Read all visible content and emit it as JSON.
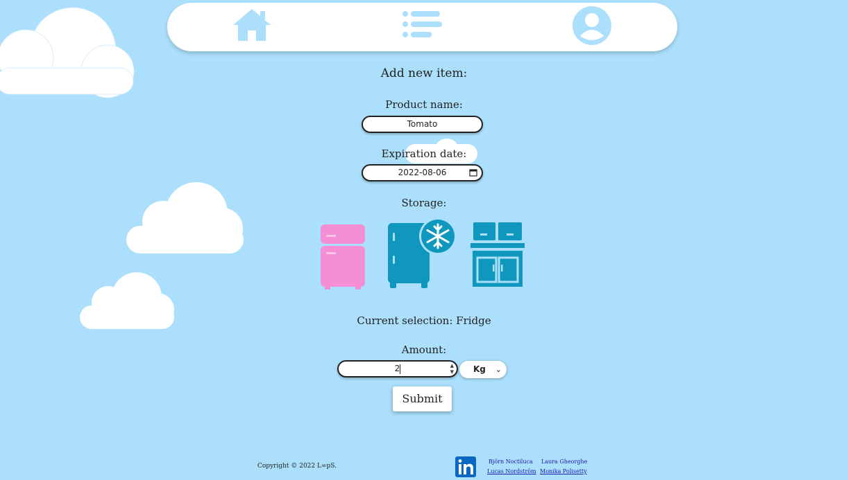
{
  "nav": {
    "home_icon": "home-icon",
    "list_icon": "list-icon",
    "profile_icon": "user-avatar-icon"
  },
  "form": {
    "heading": "Add new item:",
    "product_label": "Product name:",
    "product_value": "Tomato",
    "expiration_label": "Expiration date:",
    "expiration_value": "2022-08-06",
    "storage_label": "Storage:",
    "storage_options": [
      {
        "name": "Fridge",
        "icon": "fridge-icon",
        "color": "#f48fd6"
      },
      {
        "name": "Freezer",
        "icon": "freezer-icon",
        "color": "#0f97be"
      },
      {
        "name": "Cupboard",
        "icon": "cupboard-icon",
        "color": "#0f97be"
      }
    ],
    "current_selection": "Current selection: Fridge",
    "amount_label": "Amount:",
    "amount_value": "2",
    "unit_value": "Kg",
    "submit_label": "Submit"
  },
  "footer": {
    "copyright": "Copyright © 2022 L∞pS.",
    "linkedin_icon": "linkedin-icon",
    "people": [
      "Björn Noctiluca",
      "Lucas Nordström",
      "Laura Gheorghe",
      "Monika Polisetty"
    ]
  },
  "colors": {
    "background": "#abdffb",
    "nav_icon": "#abdffb",
    "fridge_pink": "#f48fd6",
    "teal": "#0f97be",
    "linkedin_blue": "#0a66c2"
  }
}
